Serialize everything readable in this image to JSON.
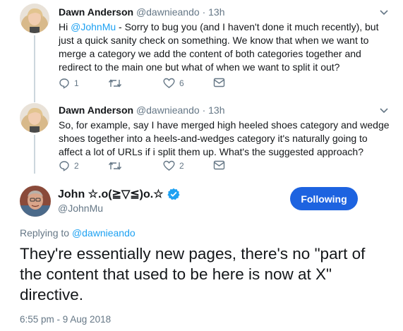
{
  "tweets": [
    {
      "name": "Dawn Anderson",
      "handle": "@dawnieando",
      "separator": "·",
      "time": "13h",
      "text_mention": "@JohnMu",
      "text_prefix": "Hi ",
      "text_rest": " - Sorry to bug you (and I haven't done it much recently), but just a quick sanity check on something.  We know that when we want to merge a category we add the content of both categories together and redirect to the main one but what of when we want to split it out?",
      "reply_count": "1",
      "retweet_count": "",
      "like_count": "6"
    },
    {
      "name": "Dawn Anderson",
      "handle": "@dawnieando",
      "separator": "·",
      "time": "13h",
      "text": "So, for example, say I have merged high heeled shoes category and wedge shoes together into a heels-and-wedges category it's naturally going to affect a lot of URLs if i split them up.  What's the suggested approach?",
      "reply_count": "2",
      "retweet_count": "",
      "like_count": "2"
    }
  ],
  "main_tweet": {
    "name": "John ☆.o(≧▽≦)o.☆",
    "handle": "@JohnMu",
    "follow_label": "Following",
    "replying_prefix": "Replying to",
    "replying_to": "@dawnieando",
    "text": "They're essentially new pages, there's no \"part of the content that used to be here is now at X\" directive.",
    "timestamp": "6:55 pm - 9 Aug 2018"
  },
  "colors": {
    "accent": "#1da1f2",
    "follow_button": "#1d63e0",
    "muted": "#657786",
    "thread_line": "#ccd6dd"
  },
  "icons": {
    "reply": "reply-icon",
    "retweet": "retweet-icon",
    "like": "heart-icon",
    "message": "envelope-icon",
    "more": "chevron-down-icon",
    "verified": "verified-badge-icon"
  }
}
